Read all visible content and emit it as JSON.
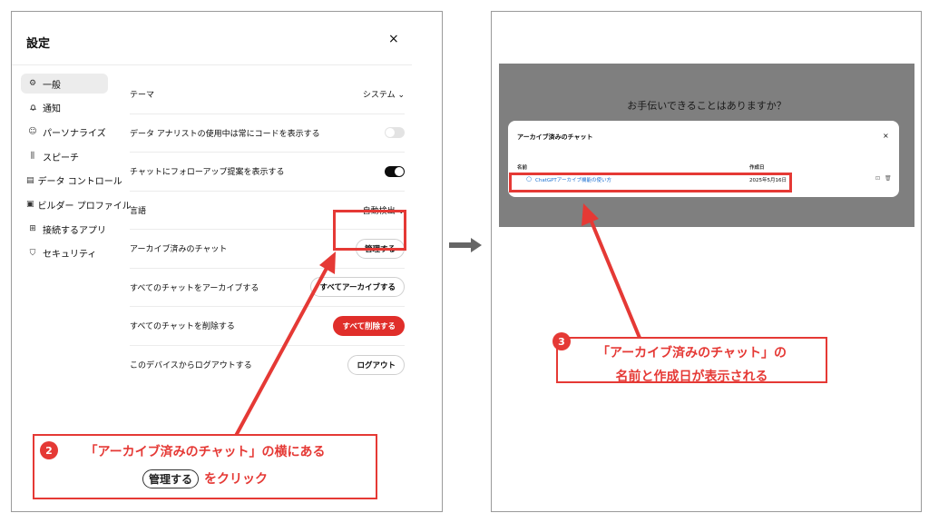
{
  "settings": {
    "title": "設定",
    "close": "×",
    "sidebar": [
      {
        "label": "一般",
        "icon": "gear-icon",
        "glyph": "⚙",
        "active": true
      },
      {
        "label": "通知",
        "icon": "bell-icon",
        "glyph": "🔔︎"
      },
      {
        "label": "パーソナライズ",
        "icon": "person-icon",
        "glyph": "☺"
      },
      {
        "label": "スピーチ",
        "icon": "waveform-icon",
        "glyph": "⫼"
      },
      {
        "label": "データ コントロール",
        "icon": "database-icon",
        "glyph": "▤"
      },
      {
        "label": "ビルダー プロファイル",
        "icon": "id-card-icon",
        "glyph": "▣"
      },
      {
        "label": "接続するアプリ",
        "icon": "apps-grid-icon",
        "glyph": "⊞"
      },
      {
        "label": "セキュリティ",
        "icon": "shield-icon",
        "glyph": "⛉"
      }
    ],
    "rows": {
      "theme": {
        "label": "テーマ",
        "value": "システム ⌄"
      },
      "code": {
        "label": "データ アナリストの使用中は常にコードを表示する"
      },
      "followup": {
        "label": "チャットにフォローアップ提案を表示する"
      },
      "language": {
        "label": "言語",
        "value": "自動検出 ⌄"
      },
      "archived": {
        "label": "アーカイブ済みのチャット",
        "button": "管理する"
      },
      "archive_all": {
        "label": "すべてのチャットをアーカイブする",
        "button": "すべてアーカイブする"
      },
      "delete_all": {
        "label": "すべてのチャットを削除する",
        "button": "すべて削除する"
      },
      "logout": {
        "label": "このデバイスからログアウトする",
        "button": "ログアウト"
      }
    }
  },
  "callout_2": {
    "number": "2",
    "line1": "「アーカイブ済みのチャット」の横にある",
    "pill": "管理する",
    "line2": "をクリック"
  },
  "archive_panel": {
    "help_text": "お手伝いできることはありますか？",
    "modal_title": "アーカイブ済みのチャット",
    "close": "×",
    "col_name": "名前",
    "col_date": "作成日",
    "chat_title": "ChatGPTアーカイブ機能の使い方",
    "chat_date": "2025年5月16日"
  },
  "callout_3": {
    "number": "3",
    "line1": "「アーカイブ済みのチャット」の",
    "line2": "名前と作成日が表示される"
  },
  "colors": {
    "accent": "#e53935",
    "danger": "#e02e2a",
    "link": "#1a6fd1"
  }
}
